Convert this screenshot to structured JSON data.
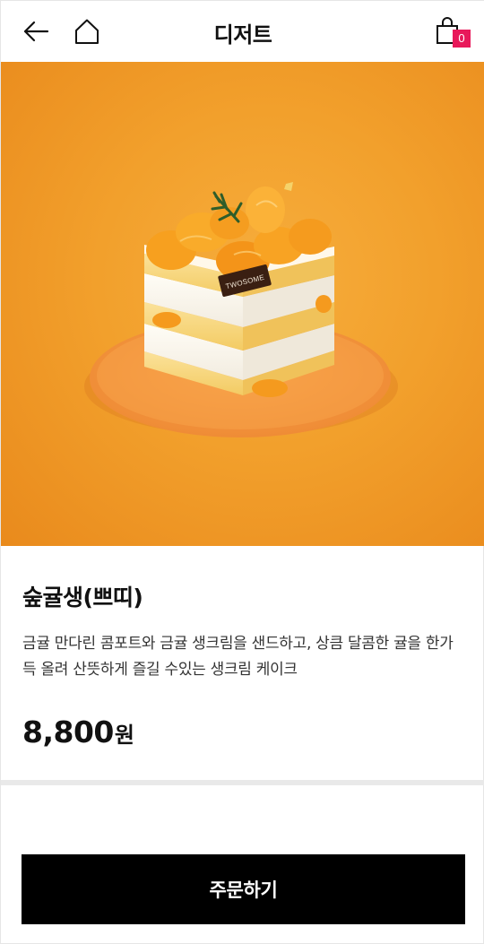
{
  "header": {
    "title": "디저트",
    "cart_count": "0"
  },
  "product": {
    "image_alt": "TWOSOME",
    "name": "숲귤생(쁘띠)",
    "description": " 금귤 만다린 콤포트와 금귤 생크림을 샌드하고, 상큼 달콤한 귤을 한가득 올려 산뜻하게 즐길 수있는 생크림 케이크",
    "price": "8,800",
    "price_unit": "원"
  },
  "actions": {
    "order_label": "주문하기"
  },
  "colors": {
    "accent_badge": "#e8195a",
    "hero_background": "#f2a02c",
    "button_bg": "#000000"
  },
  "icons": {
    "back": "arrow-left-icon",
    "home": "home-icon",
    "cart": "shopping-bag-icon"
  }
}
